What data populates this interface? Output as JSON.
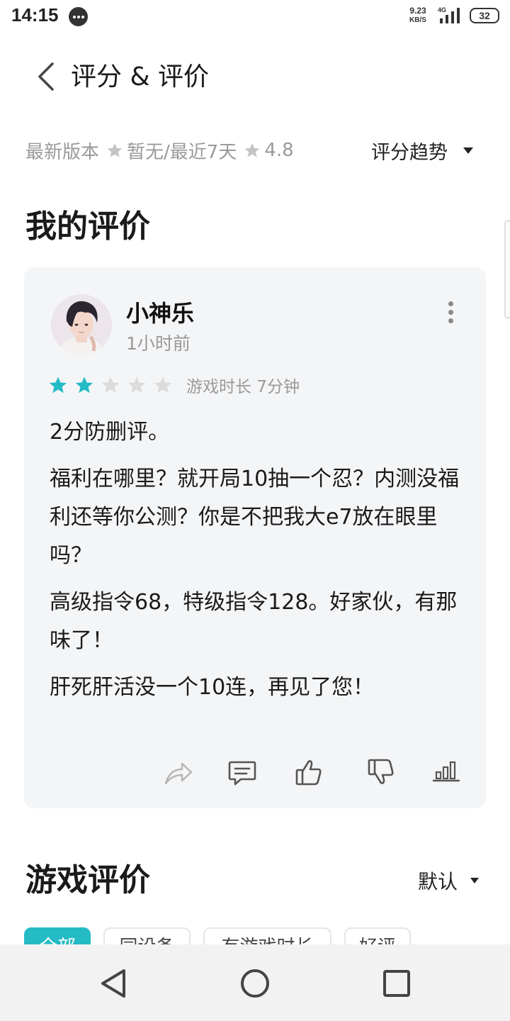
{
  "status_bar": {
    "time": "14:15",
    "net_speed_value": "9.23",
    "net_speed_unit": "KB/S",
    "network_type": "4G",
    "battery": "32"
  },
  "header": {
    "title": "评分 & 评价",
    "back_icon": "chevron-left-icon"
  },
  "rating_summary": {
    "latest_version_label": "最新版本",
    "latest_version_value": "暂无",
    "recent_label": "/最近7天",
    "recent_value": "4.8",
    "trend_label": "评分趋势"
  },
  "my_review": {
    "section_title": "我的评价",
    "user_name": "小神乐",
    "time_ago": "1小时前",
    "rating": 2,
    "rating_max": 5,
    "play_time": "游戏时长 7分钟",
    "paragraphs": [
      "2分防删评。",
      "福利在哪里？就开局10抽一个忍？内测没福利还等你公测？你是不把我大e7放在眼里吗？",
      "高级指令68，特级指令128。好家伙，有那味了！",
      "肝死肝活没一个10连，再见了您！"
    ],
    "actions": [
      "share-icon",
      "comment-icon",
      "thumbs-up-icon",
      "thumbs-down-icon",
      "stats-icon"
    ]
  },
  "game_reviews": {
    "section_title": "游戏评价",
    "sort_label": "默认",
    "filters": [
      "全部",
      "同设备",
      "有游戏时长",
      "好评"
    ],
    "active_filter": 0
  },
  "colors": {
    "accent": "#25bbc4",
    "star_active": "#25bbc4",
    "star_inactive": "#dcdcdc",
    "card_bg": "#f4f5f7",
    "muted_text": "#9a9a9a"
  }
}
